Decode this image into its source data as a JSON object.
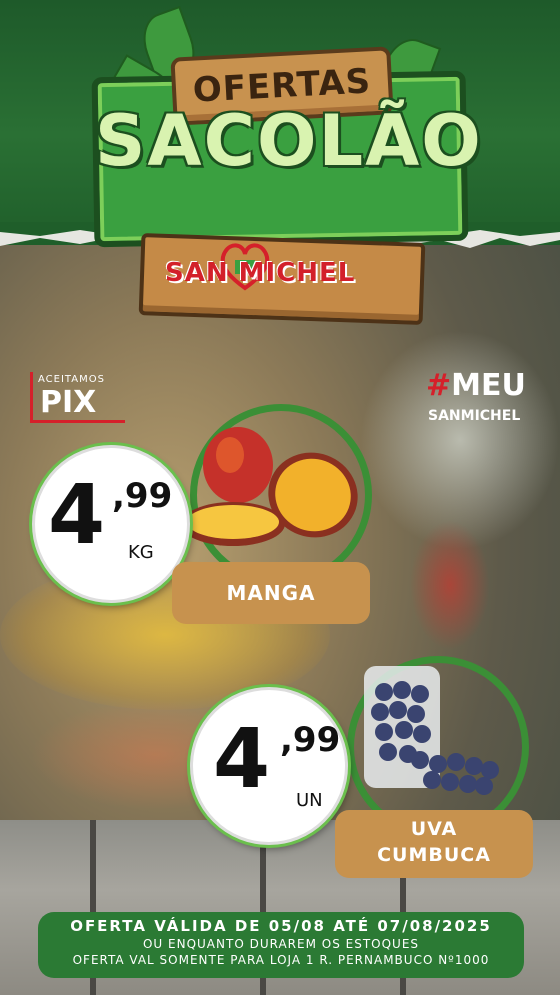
{
  "header": {
    "ofertas": "OFERTAS",
    "title": "SACOLÃO",
    "brand": "SAN MICHEL"
  },
  "badges": {
    "pix_small": "ACEITAMOS",
    "pix_big": "PIX",
    "hashtag_symbol": "#",
    "hashtag_word": "MEU",
    "hashtag_sub": "SANMICHEL"
  },
  "products": [
    {
      "name": "MANGA",
      "price_int": "4",
      "price_dec": ",99",
      "unit": "KG"
    },
    {
      "name_line1": "UVA",
      "name_line2": "CUMBUCA",
      "price_int": "4",
      "price_dec": ",99",
      "unit": "UN"
    }
  ],
  "footer": {
    "line1": "OFERTA VÁLIDA DE 05/08 ATÉ 07/08/2025",
    "line2": "OU ENQUANTO DURAREM OS ESTOQUES",
    "line3": "OFERTA VAL SOMENTE PARA LOJA 1 R. PERNAMBUCO Nº1000"
  },
  "colors": {
    "brand_green": "#2b7a34",
    "brand_red": "#d5202a",
    "wood": "#c7924e"
  }
}
